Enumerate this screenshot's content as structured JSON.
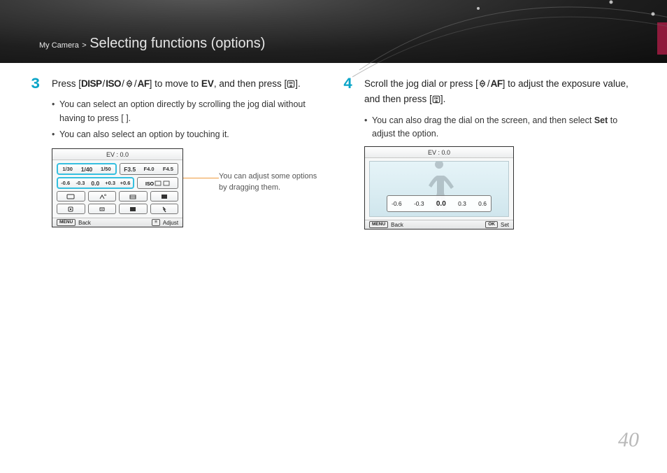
{
  "breadcrumb": {
    "section": "My Camera",
    "sep": ">",
    "title": "Selecting functions (options)"
  },
  "page_number": "40",
  "step3": {
    "num": "3",
    "text_a": "Press [",
    "disp": "DISP",
    "iso": "ISO",
    "af": "AF",
    "text_b": "] to move to ",
    "ev": "EV",
    "text_c": ", and then press [",
    "text_d": "].",
    "bullets": [
      "You can select an option directly by scrolling the jog dial without having to press [    ].",
      "You can also select an option by touching it."
    ]
  },
  "step4": {
    "num": "4",
    "text_a": "Scroll the jog dial or press [",
    "af": "AF",
    "text_b": "] to adjust the exposure value, and then press [",
    "text_c": "].",
    "bullets": [
      "You can also drag the dial on the screen, and then select Set to adjust the option."
    ],
    "bullet_pre": "You can also drag the dial on the screen, and then select ",
    "bullet_set": "Set",
    "bullet_post": " to adjust the option."
  },
  "screen1": {
    "title": "EV : 0.0",
    "shutter": {
      "left": "1/30",
      "mid": "1/40",
      "right": "1/50"
    },
    "aperture": {
      "left": "F3.5",
      "mid": "F4.0",
      "right": "F4.5"
    },
    "ev": {
      "v1": "-0.6",
      "v2": "-0.3",
      "v3": "0.0",
      "v4": "+0.3",
      "v5": "+0.6"
    },
    "iso": {
      "v1": "",
      "v2": "",
      "v3": ""
    },
    "foot_back_btn": "MENU",
    "foot_back": "Back",
    "foot_adj_btn": "≡",
    "foot_adj": "Adjust"
  },
  "callout": "You can adjust some options by dragging them.",
  "screen2": {
    "title": "EV : 0.0",
    "ev": {
      "v1": "-0.6",
      "v2": "-0.3",
      "v3": "0.0",
      "v4": "0.3",
      "v5": "0.6"
    },
    "foot_back_btn": "MENU",
    "foot_back": "Back",
    "foot_set_btn": "OK",
    "foot_set": "Set"
  }
}
